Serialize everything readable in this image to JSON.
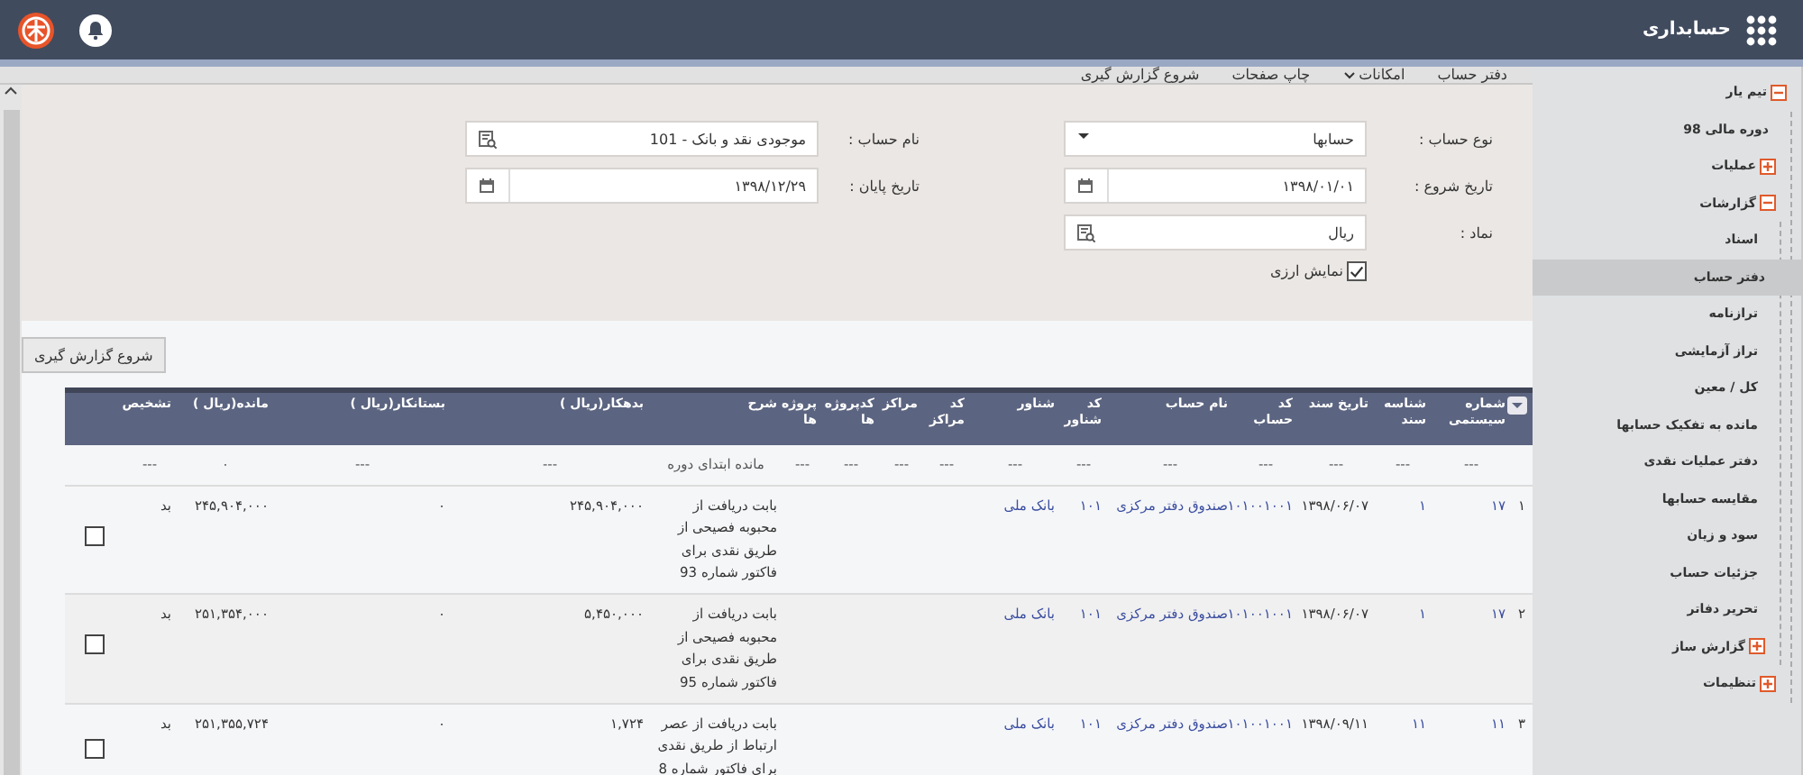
{
  "app": {
    "title": "حسابداری"
  },
  "toolbar": [
    "دفتر حساب",
    {
      "label": "امکانات",
      "menu": true
    },
    "چاپ صفحات",
    "شروع گزارش گیری"
  ],
  "form": {
    "fields": [
      {
        "label": "نوع حساب :",
        "kind": "select",
        "value": "حسابها"
      },
      {
        "label": "نام حساب :",
        "kind": "lookup",
        "value": "موجودی نقد و بانک - 101"
      },
      {
        "label": "تاریخ شروع :",
        "kind": "date",
        "value": "۱۳۹۸/۰۱/۰۱"
      },
      {
        "label": "تاریخ پایان :",
        "kind": "date",
        "value": "۱۳۹۸/۱۲/۲۹"
      },
      {
        "label": "نماد :",
        "kind": "lookup",
        "value": "ریال"
      }
    ],
    "currency_checkbox": {
      "label": "نمایش ارزی",
      "checked": true
    },
    "submit_button": "شروع گزارش گیری"
  },
  "table": {
    "columns": [
      "شماره سیستمی",
      "شناسه سند",
      "تاریخ سند",
      "کد حساب",
      "نام حساب",
      "کد شناور",
      "شناور",
      "کد مراکز",
      "مراکز",
      "کدپروژه ها",
      "پروژه ها",
      "شرح",
      "بدهکار(ریال )",
      "بستانکار(ریال )",
      "مانده(ریال )",
      "تشخیص"
    ],
    "rows": [
      {
        "kind": "opening",
        "cells": [
          "---",
          "---",
          "---",
          "---",
          "---",
          "---",
          "---",
          "---",
          "---",
          "---",
          "---",
          "مانده ابتدای دوره",
          "---",
          "---",
          "۰",
          "---"
        ]
      },
      {
        "kind": "entry",
        "number": "۱",
        "checked": false,
        "cells": [
          "۱۷",
          "۱",
          "۱۳۹۸/۰۶/۰۷",
          "۱۰۱۰۰۱۰۰۱",
          "صندوق دفتر مرکزی",
          "۱۰۱",
          "بانک ملی",
          null,
          null,
          null,
          null,
          "بابت دریافت از محبوبه فصیحی از طریق نقدی برای فاکتور شماره 93",
          "۲۴۵,۹۰۴,۰۰۰",
          "۰",
          "۲۴۵,۹۰۴,۰۰۰",
          "بد"
        ]
      },
      {
        "kind": "entry",
        "number": "۲",
        "checked": false,
        "cells": [
          "۱۷",
          "۱",
          "۱۳۹۸/۰۶/۰۷",
          "۱۰۱۰۰۱۰۰۱",
          "صندوق دفتر مرکزی",
          "۱۰۱",
          "بانک ملی",
          null,
          null,
          null,
          null,
          "بابت دریافت از محبوبه فصیحی از طریق نقدی برای فاکتور شماره 95",
          "۵,۴۵۰,۰۰۰",
          "۰",
          "۲۵۱,۳۵۴,۰۰۰",
          "بد"
        ]
      },
      {
        "kind": "entry",
        "number": "۳",
        "checked": false,
        "cells": [
          "۱۱",
          "۱۱",
          "۱۳۹۸/۰۹/۱۱",
          "۱۰۱۰۰۱۰۰۱",
          "صندوق دفتر مرکزی",
          "۱۰۱",
          "بانک ملی",
          null,
          null,
          null,
          null,
          "بابت دریافت از عصر ارتباط از طریق نقدی برای فاکتور شماره 8",
          "۱,۷۲۴",
          "۰",
          "۲۵۱,۳۵۵,۷۲۴",
          "بد"
        ]
      }
    ]
  },
  "sidebar": {
    "items": [
      {
        "label": "تیم یار",
        "expanded": true,
        "selected": false,
        "children": [
          {
            "label": "دوره مالی 98",
            "selected": false
          },
          {
            "label": "عملیات",
            "expanded": false,
            "selected": false
          },
          {
            "label": "گزارشات",
            "expanded": true,
            "selected": false,
            "children": [
              {
                "label": "اسناد",
                "selected": false
              },
              {
                "label": "دفتر حساب",
                "selected": true
              },
              {
                "label": "ترازنامه",
                "selected": false
              },
              {
                "label": "تراز آزمایشی",
                "selected": false
              },
              {
                "label": "کل / معین",
                "selected": false
              },
              {
                "label": "مانده به تفکیک حسابها",
                "selected": false
              },
              {
                "label": "دفتر عملیات نقدی",
                "selected": false
              },
              {
                "label": "مقایسه حسابها",
                "selected": false
              },
              {
                "label": "سود و زیان",
                "selected": false
              },
              {
                "label": "جزئیات حساب",
                "selected": false
              },
              {
                "label": "تحریر دفاتر",
                "selected": false
              },
              {
                "label": "گزارش ساز",
                "expanded": false,
                "selected": false
              }
            ]
          },
          {
            "label": "تنظیمات",
            "expanded": false,
            "selected": false
          }
        ]
      }
    ]
  }
}
